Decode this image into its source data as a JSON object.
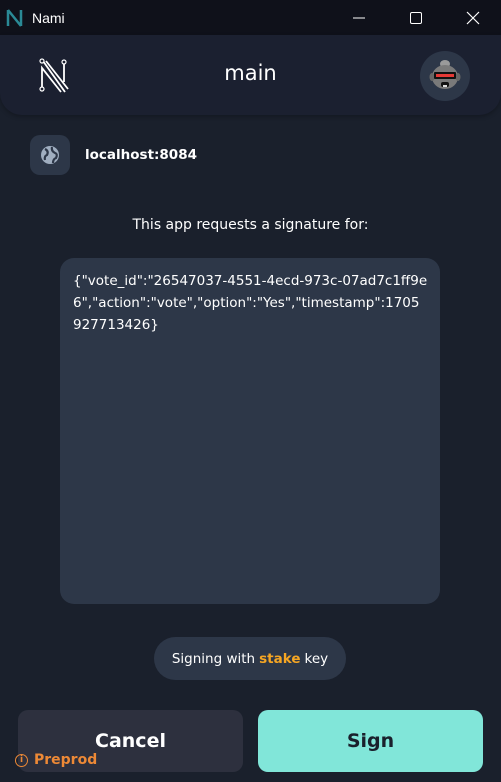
{
  "window": {
    "title": "Nami",
    "controls": [
      "minimize",
      "maximize",
      "close"
    ]
  },
  "header": {
    "account_name": "main",
    "logo_icon": "nami-logo-icon",
    "avatar_icon": "robot-avatar-icon"
  },
  "origin": {
    "icon": "globe-icon",
    "host": "localhost:8084"
  },
  "request": {
    "label": "This app requests a signature for:",
    "payload": "{\"vote_id\":\"26547037-4551-4ecd-973c-07ad7c1ff9e6\",\"action\":\"vote\",\"option\":\"Yes\",\"timestamp\":1705927713426}"
  },
  "signing": {
    "prefix": "Signing with",
    "key_type": "stake",
    "suffix": "key",
    "key_color": "#f6a623"
  },
  "actions": {
    "cancel_label": "Cancel",
    "sign_label": "Sign"
  },
  "network": {
    "icon": "info-icon",
    "label": "Preprod",
    "color": "#ed8936"
  },
  "colors": {
    "background": "#1a202c",
    "surface": "#2d3748",
    "accent": "#81e6d9"
  }
}
